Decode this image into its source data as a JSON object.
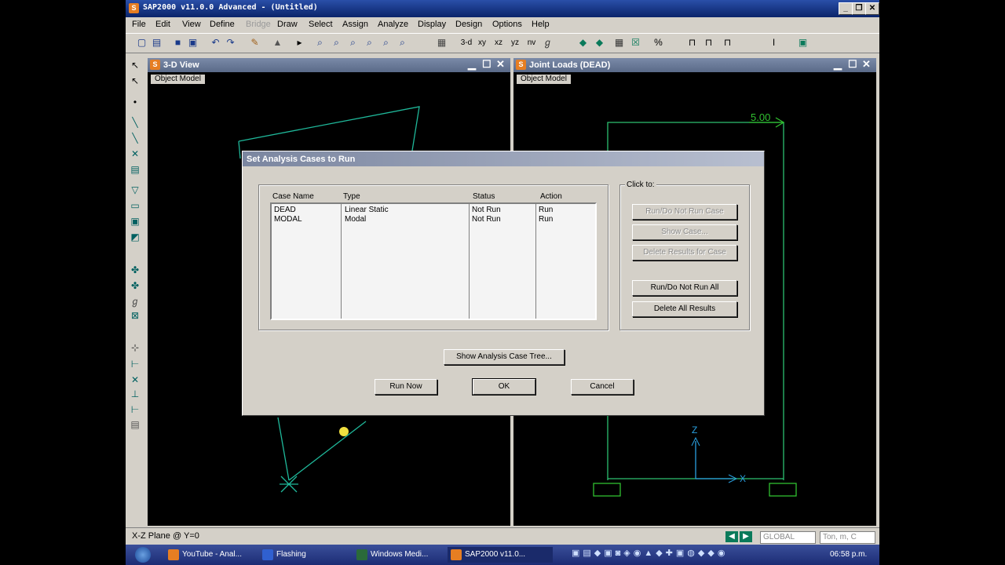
{
  "app": {
    "title": "SAP2000 v11.0.0 Advanced  - (Untitled)",
    "icon_label": "S",
    "window_controls": [
      "_",
      "❐",
      "✕"
    ]
  },
  "menu": [
    "File",
    "Edit",
    "View",
    "Define",
    "Bridge",
    "Draw",
    "Select",
    "Assign",
    "Analyze",
    "Display",
    "Design",
    "Options",
    "Help"
  ],
  "toolbar": {
    "labels": [
      "3-d",
      "xy",
      "xz",
      "yz",
      "nv"
    ],
    "icons": [
      "new-icon",
      "open-icon",
      "save-icon",
      "print-icon",
      "undo-icon",
      "redo-icon",
      "pencil-icon",
      "lock-icon",
      "run-icon",
      "zoom-rubber-icon",
      "zoom-in-icon",
      "zoom-out-icon",
      "pan-icon",
      "refresh-icon",
      "3d-view-icon"
    ]
  },
  "windows": [
    {
      "title": "3-D View",
      "tab": "Object Model"
    },
    {
      "title": "Joint Loads (DEAD)",
      "tab": "Object Model",
      "load_label": "5.00"
    }
  ],
  "axes": {
    "z": "Z",
    "x": "X"
  },
  "dialog": {
    "title": "Set Analysis Cases to Run",
    "columns": [
      "Case Name",
      "Type",
      "Status",
      "Action"
    ],
    "rows": [
      {
        "name": "DEAD",
        "type": "Linear Static",
        "status": "Not Run",
        "action": "Run"
      },
      {
        "name": "MODAL",
        "type": "Modal",
        "status": "Not Run",
        "action": "Run"
      }
    ],
    "click_to_label": "Click to:",
    "side_buttons": {
      "run_not_run_case": "Run/Do Not Run Case",
      "show_case": "Show Case...",
      "delete_results_case": "Delete Results for Case",
      "run_not_run_all": "Run/Do Not Run All",
      "delete_all_results": "Delete All Results"
    },
    "show_tree": "Show Analysis Case Tree...",
    "run_now": "Run Now",
    "ok": "OK",
    "cancel": "Cancel"
  },
  "status": {
    "text": "X-Z Plane @ Y=0",
    "coord_system": "GLOBAL",
    "units": "Ton, m, C"
  },
  "taskbar": {
    "items": [
      "YouTube - Anal...",
      "Flashing",
      "Windows Medi...",
      "SAP2000 v11.0..."
    ],
    "clock": "06:58 p.m."
  }
}
